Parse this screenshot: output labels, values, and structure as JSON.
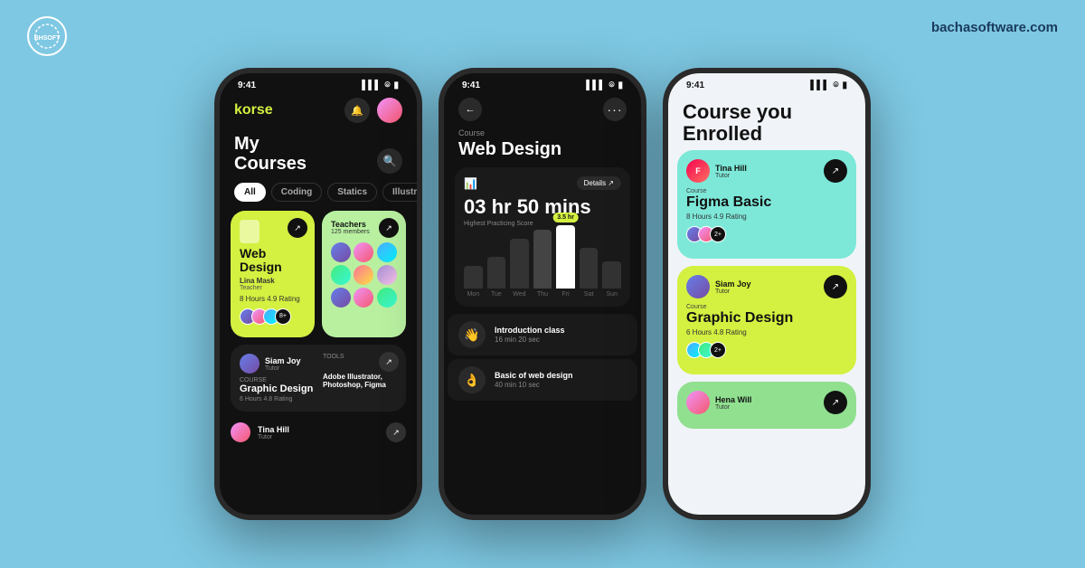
{
  "branding": {
    "logo_text": "BHSOFT",
    "site_url": "bachasoftware.com"
  },
  "phone1": {
    "status_time": "9:41",
    "app_name": "korse",
    "tabs": [
      "All",
      "Coding",
      "Statics",
      "Illustration"
    ],
    "active_tab": "All",
    "card1": {
      "title": "Web Design",
      "teacher": "Lina Mask",
      "teacher_role": "Teacher",
      "hours": "8 Hours",
      "rating": "4.9 Rating",
      "extra_count": "8+"
    },
    "card2": {
      "title": "Teachers",
      "members": "125 members"
    },
    "bottom_card": {
      "tutor": "Siam Joy",
      "tutor_role": "Tutor",
      "course_label": "Course",
      "course_title": "Graphic Design",
      "hours": "6 Hours",
      "rating": "4.8 Rating",
      "tools_label": "Tools",
      "tools": "Adobe Illustrator, Photoshop, Figma"
    },
    "tina_card": {
      "name": "Tina Hill",
      "role": "Tutor"
    }
  },
  "phone2": {
    "status_time": "9:41",
    "course_label": "Course",
    "course_title": "Web Design",
    "time_display": "03 hr 50 mins",
    "chart_subtitle": "Highest Practicing Score",
    "score_tag": "3.5 hr",
    "details_btn": "Details ↗",
    "days": [
      "Mon",
      "Tue",
      "Wed",
      "Thu",
      "Fri",
      "Sat",
      "Sun"
    ],
    "lessons": [
      {
        "icon": "👋",
        "title": "Introduction class",
        "duration": "16 min 20 sec"
      },
      {
        "icon": "👌",
        "title": "Basic of web design",
        "duration": "40 min 10 sec"
      }
    ]
  },
  "phone3": {
    "status_time": "9:41",
    "heading": "Course you Enrolled",
    "cards": [
      {
        "tutor": "Tina Hill",
        "tutor_role": "Tutor",
        "course_label": "Course",
        "course_title": "Figma Basic",
        "hours": "8 Hours",
        "rating": "4.9 Rating",
        "extra_count": "2+",
        "color": "cyan"
      },
      {
        "tutor": "Siam Joy",
        "tutor_role": "Tutor",
        "course_label": "Course",
        "course_title": "Graphic Design",
        "hours": "6 Hours",
        "rating": "4.8 Rating",
        "extra_count": "2+",
        "color": "yellow"
      },
      {
        "tutor": "Hena Will",
        "tutor_role": "Tutor",
        "color": "green"
      }
    ]
  }
}
